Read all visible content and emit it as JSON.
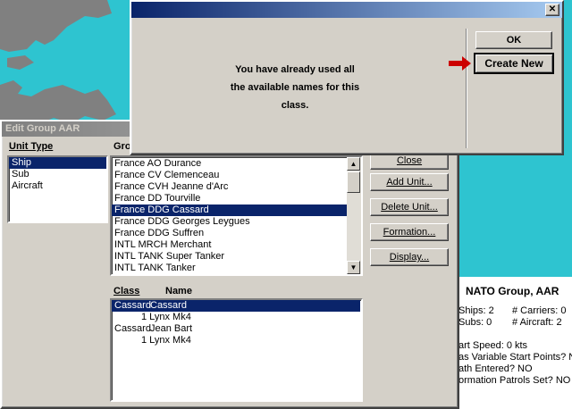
{
  "map": {
    "sea_color": "#2ec4d0",
    "land_color": "#808080"
  },
  "alert": {
    "close_glyph": "✕",
    "message_lines": [
      "You have already used all",
      "the available names for this",
      "class."
    ],
    "ok_label": "OK",
    "create_new_label": "Create New",
    "arrow_color": "#cc0000"
  },
  "edit_group": {
    "title": "Edit Group AAR",
    "unit_type_label": "Unit Type",
    "unit_types": [
      "Ship",
      "Sub",
      "Aircraft"
    ],
    "selected_unit_type": "Ship",
    "group_label": "Gro",
    "group_list": [
      "France AO   Durance",
      "France CV   Clemenceau",
      "France CVH  Jeanne d'Arc",
      "France DD   Tourville",
      "France DDG  Cassard",
      "France DDG  Georges Leygues",
      "France DDG  Suffren",
      "INTL MRCH Merchant",
      "INTL TANK Super Tanker",
      "INTL TANK Tanker"
    ],
    "selected_group": "France DDG  Cassard",
    "buttons": {
      "close": "Close",
      "add_unit": "Add Unit...",
      "delete_unit": "Delete Unit...",
      "formation": "Formation...",
      "display": "Display..."
    },
    "class_header": "Class",
    "name_header": "Name",
    "units": [
      {
        "class": "Cassard",
        "name": "Cassard",
        "selected": true
      },
      {
        "class": "",
        "name": "1 Lynx Mk4",
        "selected": false
      },
      {
        "class": "Cassard",
        "name": "Jean Bart",
        "selected": false
      },
      {
        "class": "",
        "name": "1 Lynx Mk4",
        "selected": false
      }
    ]
  },
  "group_info": {
    "title": "NATO Group, AAR",
    "ships": "Ships: 2",
    "carriers": "# Carriers: 0",
    "subs": "Subs:  0",
    "aircraft": "# Aircraft: 2",
    "lines": [
      "art Speed: 0 kts",
      "as Variable Start Points? NO",
      "ath Entered? NO",
      "ormation Patrols Set? NO"
    ]
  }
}
